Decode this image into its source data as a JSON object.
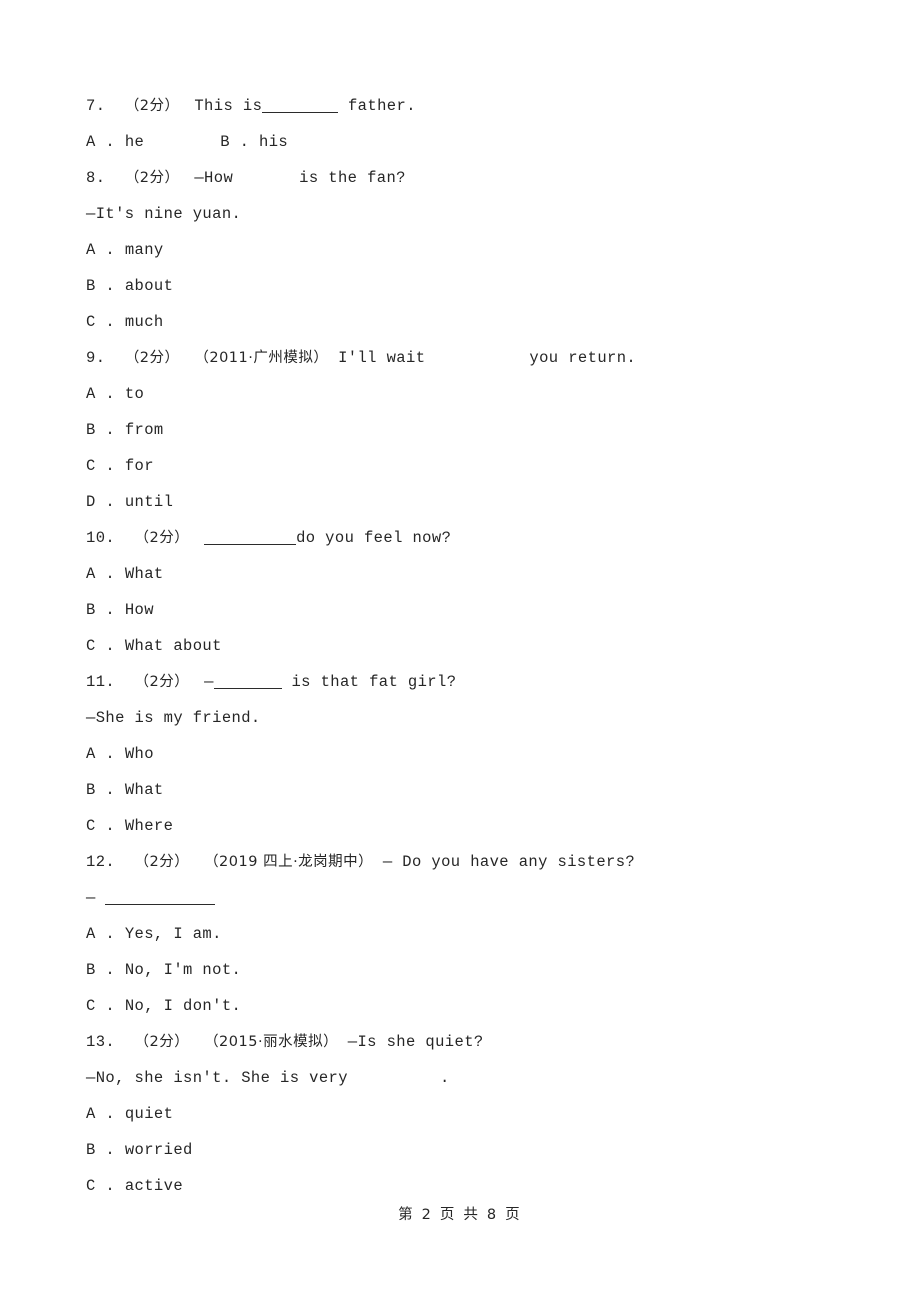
{
  "document": {
    "type": "exam-paper",
    "language": "en-zh",
    "background_color": "#ffffff",
    "text_color": "#262626"
  },
  "questions": [
    {
      "number": "7.",
      "score": "（2分）",
      "source": "",
      "lines": [
        {
          "kind": "stem",
          "before": "This is",
          "blank_width": 76,
          "after": " father."
        }
      ],
      "options_inline": [
        {
          "label": "A",
          "sep": " . ",
          "text": "he"
        },
        {
          "label": "B",
          "sep": " . ",
          "text": "his"
        }
      ],
      "options": []
    },
    {
      "number": "8.",
      "score": "（2分）",
      "source": "",
      "lines": [
        {
          "kind": "stem-gap",
          "before": "—How",
          "gap_width": 66,
          "after": "is the fan?"
        },
        {
          "kind": "plain",
          "text": "—It's nine yuan."
        }
      ],
      "options_inline": [],
      "options": [
        {
          "label": "A",
          "sep": " . ",
          "text": "many"
        },
        {
          "label": "B",
          "sep": " . ",
          "text": "about"
        },
        {
          "label": "C",
          "sep": " . ",
          "text": "much"
        }
      ]
    },
    {
      "number": "9.",
      "score": "（2分）",
      "source": "（2011·广州模拟）",
      "lines": [
        {
          "kind": "stem-gap",
          "before": "I'll wait",
          "gap_width": 104,
          "after": "you return."
        }
      ],
      "options_inline": [],
      "options": [
        {
          "label": "A",
          "sep": " . ",
          "text": "to"
        },
        {
          "label": "B",
          "sep": " . ",
          "text": "from"
        },
        {
          "label": "C",
          "sep": " . ",
          "text": "for"
        },
        {
          "label": "D",
          "sep": " . ",
          "text": "until"
        }
      ]
    },
    {
      "number": "10.",
      "score": "（2分）",
      "source": "",
      "lines": [
        {
          "kind": "stem-lead-blank",
          "blank_width": 92,
          "after": "do you feel now?"
        }
      ],
      "options_inline": [],
      "options": [
        {
          "label": "A",
          "sep": " . ",
          "text": "What"
        },
        {
          "label": "B",
          "sep": " . ",
          "text": "How"
        },
        {
          "label": "C",
          "sep": " . ",
          "text": "What about"
        }
      ]
    },
    {
      "number": "11.",
      "score": "（2分）",
      "source": "",
      "lines": [
        {
          "kind": "stem-dash-blank",
          "dash": "—",
          "blank_width": 68,
          "after": " is that fat girl?"
        },
        {
          "kind": "plain",
          "text": "—She is my friend."
        }
      ],
      "options_inline": [],
      "options": [
        {
          "label": "A",
          "sep": " . ",
          "text": "Who"
        },
        {
          "label": "B",
          "sep": " . ",
          "text": "What"
        },
        {
          "label": "C",
          "sep": " . ",
          "text": "Where"
        }
      ]
    },
    {
      "number": "12.",
      "score": "（2分）",
      "source": "（2019 四上·龙岗期中）",
      "lines": [
        {
          "kind": "plain-after-source",
          "text": "— Do you have any sisters?"
        },
        {
          "kind": "dash-long-blank",
          "dash": "—",
          "blank_width": 110
        }
      ],
      "options_inline": [],
      "options": [
        {
          "label": "A",
          "sep": " . ",
          "text": "Yes, I am."
        },
        {
          "label": "B",
          "sep": " . ",
          "text": "No, I'm not."
        },
        {
          "label": "C",
          "sep": " . ",
          "text": "No, I don't."
        }
      ]
    },
    {
      "number": "13.",
      "score": "（2分）",
      "source": "（2015·丽水模拟）",
      "lines": [
        {
          "kind": "plain-after-source",
          "text": "—Is she quiet?"
        },
        {
          "kind": "stem-gap",
          "before": "—No, she isn't. She is very",
          "gap_width": 92,
          "after": "."
        }
      ],
      "options_inline": [],
      "options": [
        {
          "label": "A",
          "sep": " . ",
          "text": "quiet"
        },
        {
          "label": "B",
          "sep": " . ",
          "text": "worried"
        },
        {
          "label": "C",
          "sep": " . ",
          "text": "active"
        }
      ]
    }
  ],
  "footer": {
    "text": "第 2 页 共 8 页",
    "current_page": "2",
    "total_pages": "8"
  }
}
